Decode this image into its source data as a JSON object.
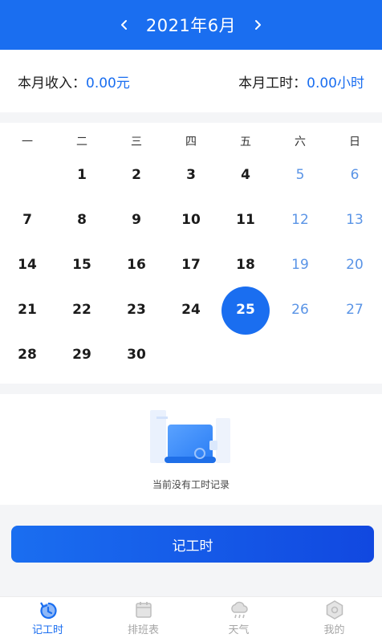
{
  "header": {
    "title": "2021年6月",
    "prev_icon": "chevron-left-icon",
    "next_icon": "chevron-right-icon"
  },
  "stats": {
    "income_label": "本月收入：",
    "income_value": "0.00元",
    "hours_label": "本月工时：",
    "hours_value": "0.00小时"
  },
  "calendar": {
    "weekdays": [
      "一",
      "二",
      "三",
      "四",
      "五",
      "六",
      "日"
    ],
    "leading_blanks": 1,
    "days": [
      "1",
      "2",
      "3",
      "4",
      "5",
      "6",
      "7",
      "8",
      "9",
      "10",
      "11",
      "12",
      "13",
      "14",
      "15",
      "16",
      "17",
      "18",
      "19",
      "20",
      "21",
      "22",
      "23",
      "24",
      "25",
      "26",
      "27",
      "28",
      "29",
      "30"
    ],
    "selected_day": "25"
  },
  "empty_state": {
    "text": "当前没有工时记录"
  },
  "record_button": {
    "label": "记工时"
  },
  "tabbar": {
    "tabs": [
      {
        "label": "记工时",
        "icon": "clock-refresh-icon",
        "active": true
      },
      {
        "label": "排班表",
        "icon": "calendar-icon",
        "active": false
      },
      {
        "label": "天气",
        "icon": "cloud-rain-icon",
        "active": false
      },
      {
        "label": "我的",
        "icon": "hexagon-user-icon",
        "active": false
      }
    ]
  },
  "colors": {
    "primary": "#1a6ef0",
    "weekend": "#5a94e6",
    "inactive": "#a6a6a6"
  }
}
